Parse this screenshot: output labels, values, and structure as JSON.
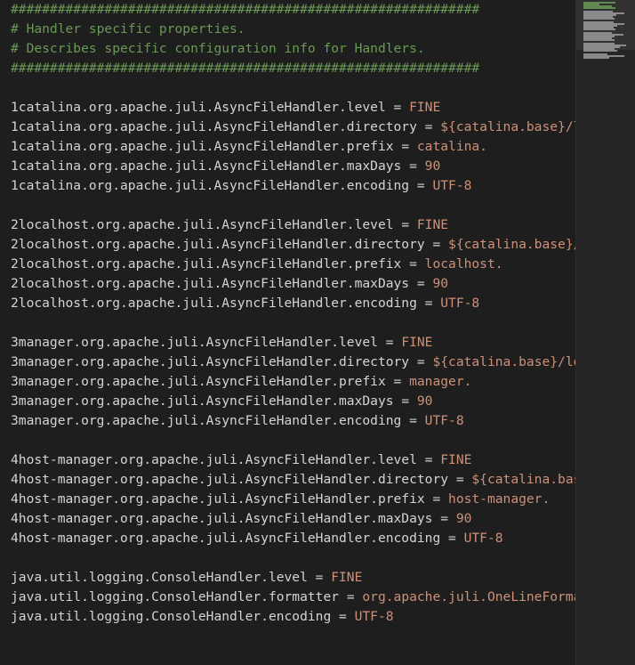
{
  "editor": {
    "theme_colors": {
      "background": "#1e1e1e",
      "comment": "#6a9955",
      "key": "#d4d4d4",
      "value": "#ce9178",
      "minimap_background": "#252526"
    },
    "lines": [
      {
        "type": "comment",
        "text": "############################################################"
      },
      {
        "type": "comment",
        "text": "# Handler specific properties."
      },
      {
        "type": "comment",
        "text": "# Describes specific configuration info for Handlers."
      },
      {
        "type": "comment",
        "text": "############################################################"
      },
      {
        "type": "blank",
        "text": ""
      },
      {
        "type": "prop",
        "key": "1catalina.org.apache.juli.AsyncFileHandler.level",
        "value": "FINE"
      },
      {
        "type": "prop",
        "key": "1catalina.org.apache.juli.AsyncFileHandler.directory",
        "value": "${catalina.base}/logs"
      },
      {
        "type": "prop",
        "key": "1catalina.org.apache.juli.AsyncFileHandler.prefix",
        "value": "catalina."
      },
      {
        "type": "prop",
        "key": "1catalina.org.apache.juli.AsyncFileHandler.maxDays",
        "value": "90"
      },
      {
        "type": "prop",
        "key": "1catalina.org.apache.juli.AsyncFileHandler.encoding",
        "value": "UTF-8"
      },
      {
        "type": "blank",
        "text": ""
      },
      {
        "type": "prop",
        "key": "2localhost.org.apache.juli.AsyncFileHandler.level",
        "value": "FINE"
      },
      {
        "type": "prop",
        "key": "2localhost.org.apache.juli.AsyncFileHandler.directory",
        "value": "${catalina.base}/logs"
      },
      {
        "type": "prop",
        "key": "2localhost.org.apache.juli.AsyncFileHandler.prefix",
        "value": "localhost."
      },
      {
        "type": "prop",
        "key": "2localhost.org.apache.juli.AsyncFileHandler.maxDays",
        "value": "90"
      },
      {
        "type": "prop",
        "key": "2localhost.org.apache.juli.AsyncFileHandler.encoding",
        "value": "UTF-8"
      },
      {
        "type": "blank",
        "text": ""
      },
      {
        "type": "prop",
        "key": "3manager.org.apache.juli.AsyncFileHandler.level",
        "value": "FINE"
      },
      {
        "type": "prop",
        "key": "3manager.org.apache.juli.AsyncFileHandler.directory",
        "value": "${catalina.base}/logs"
      },
      {
        "type": "prop",
        "key": "3manager.org.apache.juli.AsyncFileHandler.prefix",
        "value": "manager."
      },
      {
        "type": "prop",
        "key": "3manager.org.apache.juli.AsyncFileHandler.maxDays",
        "value": "90"
      },
      {
        "type": "prop",
        "key": "3manager.org.apache.juli.AsyncFileHandler.encoding",
        "value": "UTF-8"
      },
      {
        "type": "blank",
        "text": ""
      },
      {
        "type": "prop",
        "key": "4host-manager.org.apache.juli.AsyncFileHandler.level",
        "value": "FINE"
      },
      {
        "type": "prop",
        "key": "4host-manager.org.apache.juli.AsyncFileHandler.directory",
        "value": "${catalina.base}/logs"
      },
      {
        "type": "prop",
        "key": "4host-manager.org.apache.juli.AsyncFileHandler.prefix",
        "value": "host-manager."
      },
      {
        "type": "prop",
        "key": "4host-manager.org.apache.juli.AsyncFileHandler.maxDays",
        "value": "90"
      },
      {
        "type": "prop",
        "key": "4host-manager.org.apache.juli.AsyncFileHandler.encoding",
        "value": "UTF-8"
      },
      {
        "type": "blank",
        "text": ""
      },
      {
        "type": "prop",
        "key": "java.util.logging.ConsoleHandler.level",
        "value": "FINE"
      },
      {
        "type": "prop",
        "key": "java.util.logging.ConsoleHandler.formatter",
        "value": "org.apache.juli.OneLineFormatter"
      },
      {
        "type": "prop",
        "key": "java.util.logging.ConsoleHandler.encoding",
        "value": "UTF-8"
      }
    ]
  }
}
